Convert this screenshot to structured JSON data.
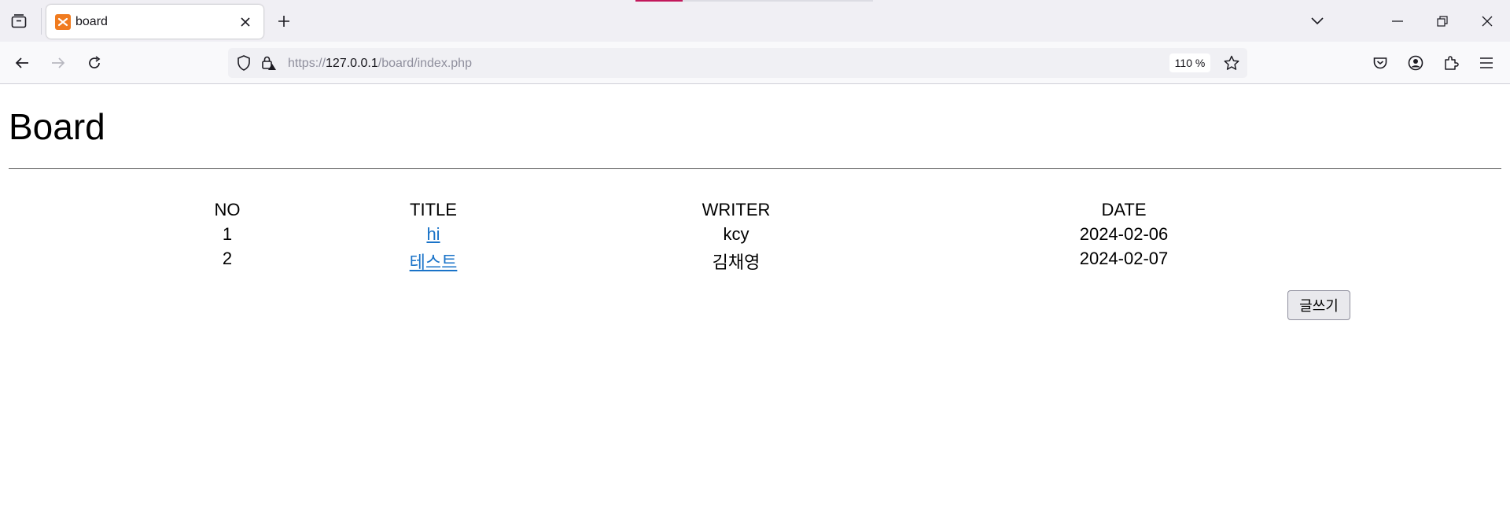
{
  "browser": {
    "tab": {
      "title": "board"
    },
    "url": {
      "scheme": "https://",
      "host": "127.0.0.1",
      "path": "/board/index.php"
    },
    "zoom": "110 %"
  },
  "page": {
    "title": "Board",
    "table": {
      "headers": {
        "no": "NO",
        "title": "TITLE",
        "writer": "WRITER",
        "date": "DATE"
      },
      "rows": [
        {
          "no": "1",
          "title": "hi",
          "writer": "kcy",
          "date": "2024-02-06"
        },
        {
          "no": "2",
          "title": "테스트",
          "writer": "김채영",
          "date": "2024-02-07"
        }
      ]
    },
    "write_button": "글쓰기"
  },
  "colors": {
    "link": "#1a73c8",
    "favicon": "#f07b1f",
    "tabbar_bg": "#f0eff4"
  },
  "icons": [
    "tab-overview-icon",
    "xampp-favicon-icon",
    "tab-close-icon",
    "new-tab-icon",
    "tab-list-chevron-icon",
    "minimize-icon",
    "restore-icon",
    "window-close-icon",
    "back-arrow-icon",
    "forward-arrow-icon",
    "reload-icon",
    "shield-icon",
    "lock-icon",
    "bookmark-star-icon",
    "pocket-icon",
    "account-icon",
    "extensions-icon",
    "menu-icon"
  ]
}
